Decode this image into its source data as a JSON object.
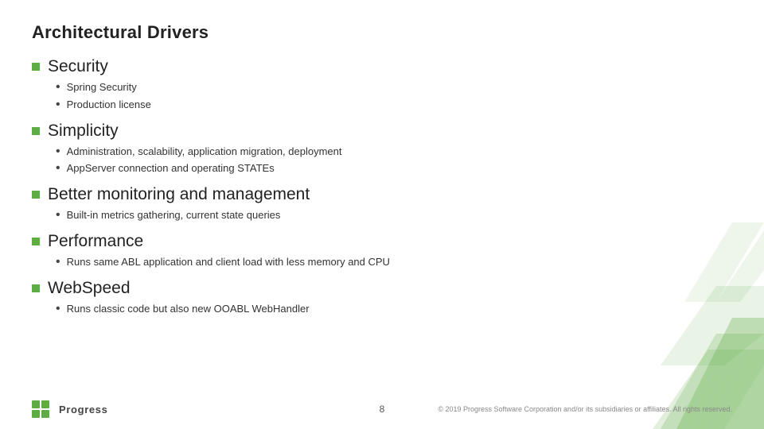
{
  "title": "Architectural Drivers",
  "sections": [
    {
      "id": "security",
      "label": "Security",
      "subitems": [
        "Spring Security",
        "Production license"
      ]
    },
    {
      "id": "simplicity",
      "label": "Simplicity",
      "subitems": [
        "Administration, scalability, application migration, deployment",
        "AppServer connection and operating STATEs"
      ]
    },
    {
      "id": "monitoring",
      "label": "Better monitoring and management",
      "subitems": [
        "Built-in metrics gathering, current state queries"
      ]
    },
    {
      "id": "performance",
      "label": "Performance",
      "subitems": [
        "Runs same ABL application and client load with less memory and CPU"
      ]
    },
    {
      "id": "webspeed",
      "label": "WebSpeed",
      "subitems": [
        "Runs classic code but also new OOABL WebHandler"
      ]
    }
  ],
  "footer": {
    "logo_text": "Progress",
    "page_number": "8",
    "copyright": "© 2019 Progress Software Corporation and/or its subsidiaries or affiliates. All rights reserved."
  }
}
